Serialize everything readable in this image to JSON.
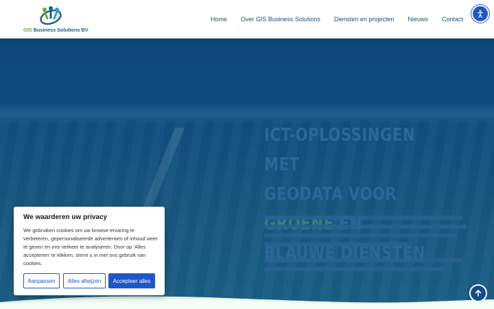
{
  "header": {
    "logo_text_gis": "GIS",
    "logo_text_rest": " Business Solutions BV",
    "nav": [
      {
        "label": "Home"
      },
      {
        "label": "Over GIS Business Solutions"
      },
      {
        "label": "Diensten en projecten"
      },
      {
        "label": "Nieuws"
      },
      {
        "label": "Contact"
      }
    ],
    "accessibility_icon": "accessibility-icon"
  },
  "hero": {
    "title_line1": "ICT-oplossingen met",
    "title_line2_a": "geodata voor ",
    "title_line2_b": "groene",
    "title_line2_c": " en",
    "title_line3": "blauwe diensten"
  },
  "cookie": {
    "title": "We waarderen uw privacy",
    "text": "We gebruiken cookies om uw browse-ervaring te verbeteren, gepersonaliseerde advertenties of inhoud weer te geven en ons verkeer te analyseren. Door op 'Alles accepteren' te klikken, stemt u in met ons gebruik van cookies.",
    "btn_customize": "Aanpassen",
    "btn_reject": "Alles afwijzen",
    "btn_accept": "Accepteer alles"
  },
  "scroll_top_icon": "arrow-up-icon",
  "colors": {
    "primary": "#1e56c7",
    "nav_text": "#1d4e78",
    "hero_bg": "#124e80"
  }
}
